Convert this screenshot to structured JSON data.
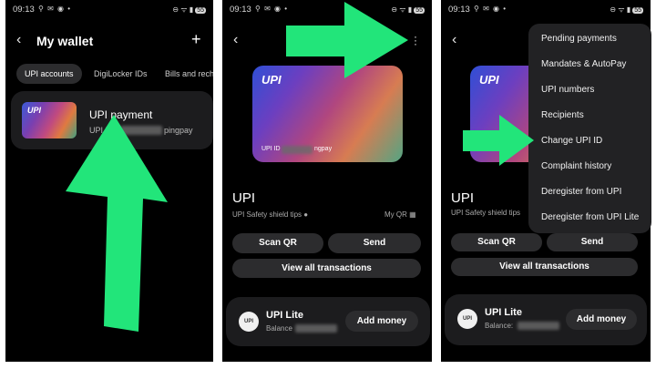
{
  "status": {
    "time": "09:13",
    "battery": "55"
  },
  "screen1": {
    "title": "My wallet",
    "tabs": [
      "UPI accounts",
      "DigiLocker IDs",
      "Bills and rech"
    ],
    "account": {
      "logo": "UPI",
      "name": "UPI payment",
      "id_prefix": "UPI ID",
      "id_suffix": "pingpay"
    }
  },
  "screen2": {
    "card": {
      "logo": "UPI",
      "id_prefix": "UPI ID",
      "id_suffix": "ngpay"
    },
    "heading": "UPI",
    "safety_tips": "UPI Safety shield tips",
    "my_qr": "My QR",
    "scan_qr": "Scan QR",
    "send": "Send",
    "view_all": "View all transactions",
    "lite": {
      "icon": "UPI",
      "name": "UPI Lite",
      "balance_label": "Balance",
      "add_money": "Add money"
    }
  },
  "screen3": {
    "heading": "UPI",
    "safety_tips": "UPI Safety shield tips",
    "scan_qr": "Scan QR",
    "send": "Send",
    "view_all": "View all transactions",
    "lite": {
      "icon": "UPI",
      "name": "UPI Lite",
      "balance_label": "Balance:",
      "add_money": "Add money"
    },
    "menu": [
      "Pending payments",
      "Mandates & AutoPay",
      "UPI numbers",
      "Recipients",
      "Change UPI ID",
      "Complaint history",
      "Deregister from UPI",
      "Deregister from UPI Lite"
    ]
  },
  "colors": {
    "arrow": "#22e57a",
    "background": "#000000",
    "surface": "#1c1c1e",
    "pill": "#2c2c2e"
  },
  "icons": [
    "back-arrow-icon",
    "plus-icon",
    "more-vert-icon",
    "qr-code-icon",
    "info-icon"
  ]
}
